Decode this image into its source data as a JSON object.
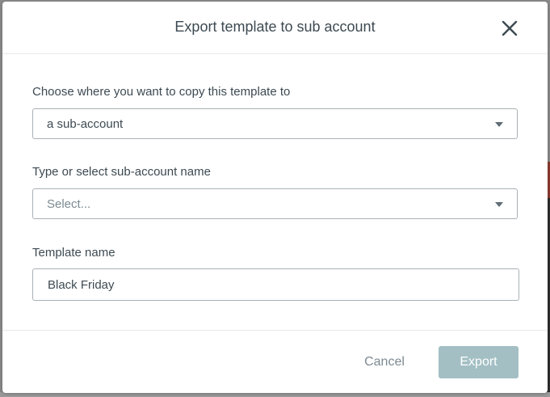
{
  "modal": {
    "title": "Export template to sub account"
  },
  "destination": {
    "label": "Choose where you want to copy this template to",
    "selected": "a sub-account"
  },
  "subaccount": {
    "label": "Type or select sub-account name",
    "placeholder": "Select..."
  },
  "template_name": {
    "label": "Template name",
    "value": "Black Friday"
  },
  "footer": {
    "cancel_label": "Cancel",
    "export_label": "Export"
  },
  "colors": {
    "export_button_disabled": "#a3bfc4",
    "text": "#3d4a52",
    "muted_text": "#7c8a92"
  }
}
